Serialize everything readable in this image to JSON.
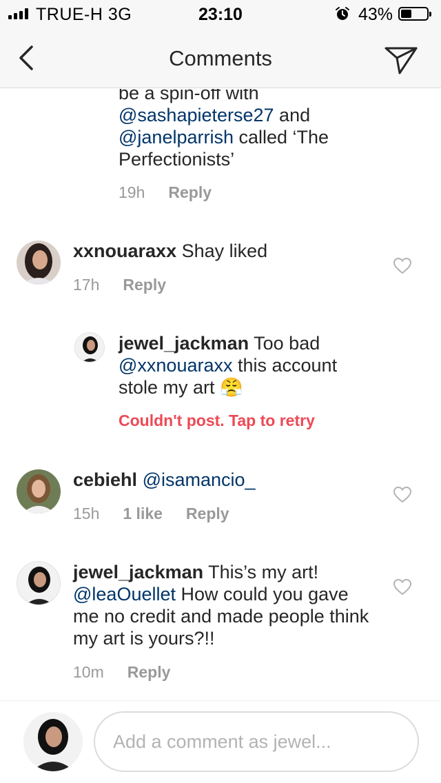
{
  "status_bar": {
    "carrier": "TRUE-H  3G",
    "time": "23:10",
    "battery": "43%",
    "battery_level": 0.43,
    "icons": [
      "signal-icon",
      "alarm-icon",
      "battery-icon"
    ]
  },
  "nav": {
    "title": "Comments",
    "back_icon": "chevron-left-icon",
    "share_icon": "paper-plane-icon"
  },
  "partial_comment": {
    "line1": "be a spin-off with",
    "mention1": "@sashapieterse27",
    "text2": " and",
    "mention2": "@janelparrish",
    "text3": "  called ‘The Perfectionists’",
    "time": "19h",
    "reply": "Reply"
  },
  "comments": [
    {
      "username": "xxnouaraxx",
      "text": " Shay liked",
      "time": "17h",
      "reply": "Reply"
    },
    {
      "username": "jewel_jackman",
      "text1": " Too bad",
      "mention": "@xxnouaraxx",
      "text2": " this account stole my art ",
      "emoji": "😤",
      "error": "Couldn't post. Tap to retry"
    },
    {
      "username": "cebiehl",
      "mention": "@isamancio_",
      "time": "15h",
      "likes": "1 like",
      "reply": "Reply"
    },
    {
      "username": "jewel_jackman",
      "text1": " This’s my art!",
      "mention": "@leaOuellet",
      "text2": " How could you gave me no credit and made people think my art is yours?!!",
      "time": "10m",
      "reply": "Reply"
    }
  ],
  "composer": {
    "placeholder": "Add a comment as jewel..."
  },
  "colors": {
    "mention": "#003569",
    "error": "#ed4956",
    "meta": "#999999",
    "text": "#262626",
    "bar_bg": "#f7f7f7"
  }
}
